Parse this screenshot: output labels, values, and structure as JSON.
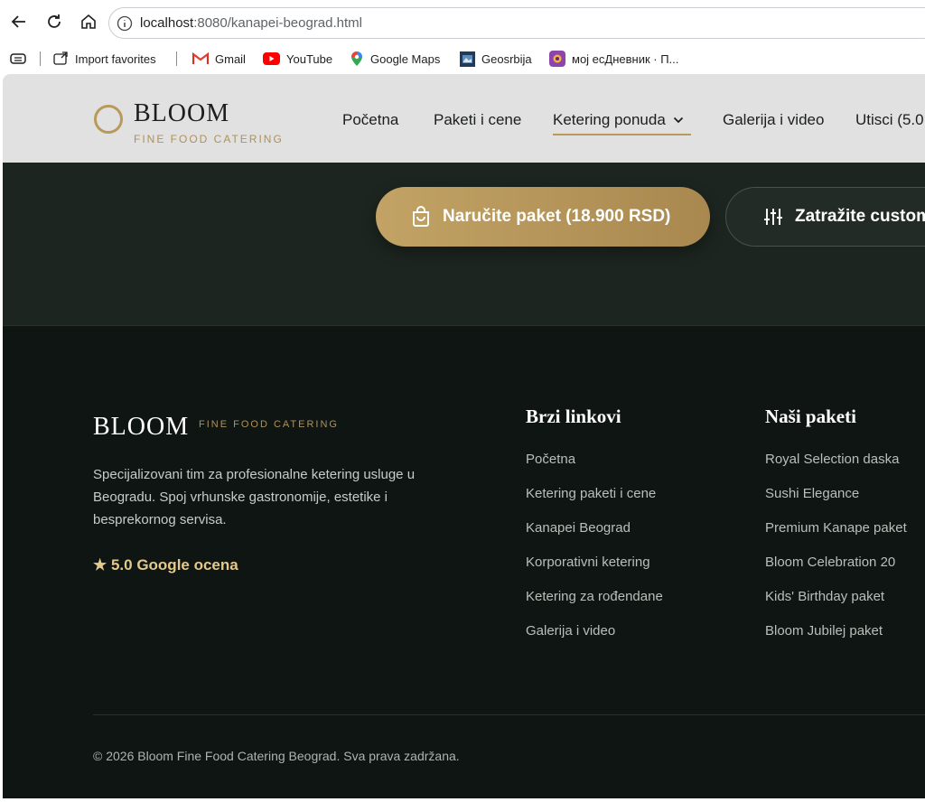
{
  "browser": {
    "url_host": "localhost",
    "url_rest": ":8080/kanapei-beograd.html",
    "bookmarks": [
      {
        "label": "Import favorites",
        "icon": "import-icon"
      },
      {
        "label": "Gmail",
        "icon": "gmail-icon"
      },
      {
        "label": "YouTube",
        "icon": "youtube-icon"
      },
      {
        "label": "Google Maps",
        "icon": "maps-icon"
      },
      {
        "label": "Geosrbija",
        "icon": "geosrbija-icon"
      },
      {
        "label": "мој есДневник · П...",
        "icon": "esdnevnik-icon"
      }
    ]
  },
  "header": {
    "logo": "BLOOM",
    "logo_sub": "FINE FOOD CATERING",
    "menu": [
      "Početna",
      "Paketi i cene",
      "Ketering ponuda",
      "Galerija i video",
      "Utisci (5.0"
    ]
  },
  "hero": {
    "order_button": "Naručite paket (18.900 RSD)",
    "custom_button": "Zatražite custom"
  },
  "footer": {
    "brand": "BLOOM",
    "brand_sub": "FINE FOOD CATERING",
    "description": "Specijalizovani tim za profesionalne ketering usluge u Beogradu. Spoj vrhunske gastronomije, estetike i besprekornog servisa.",
    "rating": "★ 5.0 Google ocena",
    "quick_links_title": "Brzi linkovi",
    "quick_links": [
      "Početna",
      "Ketering paketi i cene",
      "Kanapei Beograd",
      "Korporativni ketering",
      "Ketering za rođendane",
      "Galerija i video"
    ],
    "packages_title": "Naši paketi",
    "packages": [
      "Royal Selection daska",
      "Sushi Elegance",
      "Premium Kanape paket",
      "Bloom Celebration 20",
      "Kids' Birthday paket",
      "Bloom Jubilej paket"
    ],
    "copyright": "© 2026 Bloom Fine Food Catering Beograd. Sva prava zadržana."
  },
  "colors": {
    "gold": "#b99a5c",
    "footer_bg": "#0e1512",
    "hero_bg": "#1d2520",
    "header_bg": "#e0e1e0"
  }
}
